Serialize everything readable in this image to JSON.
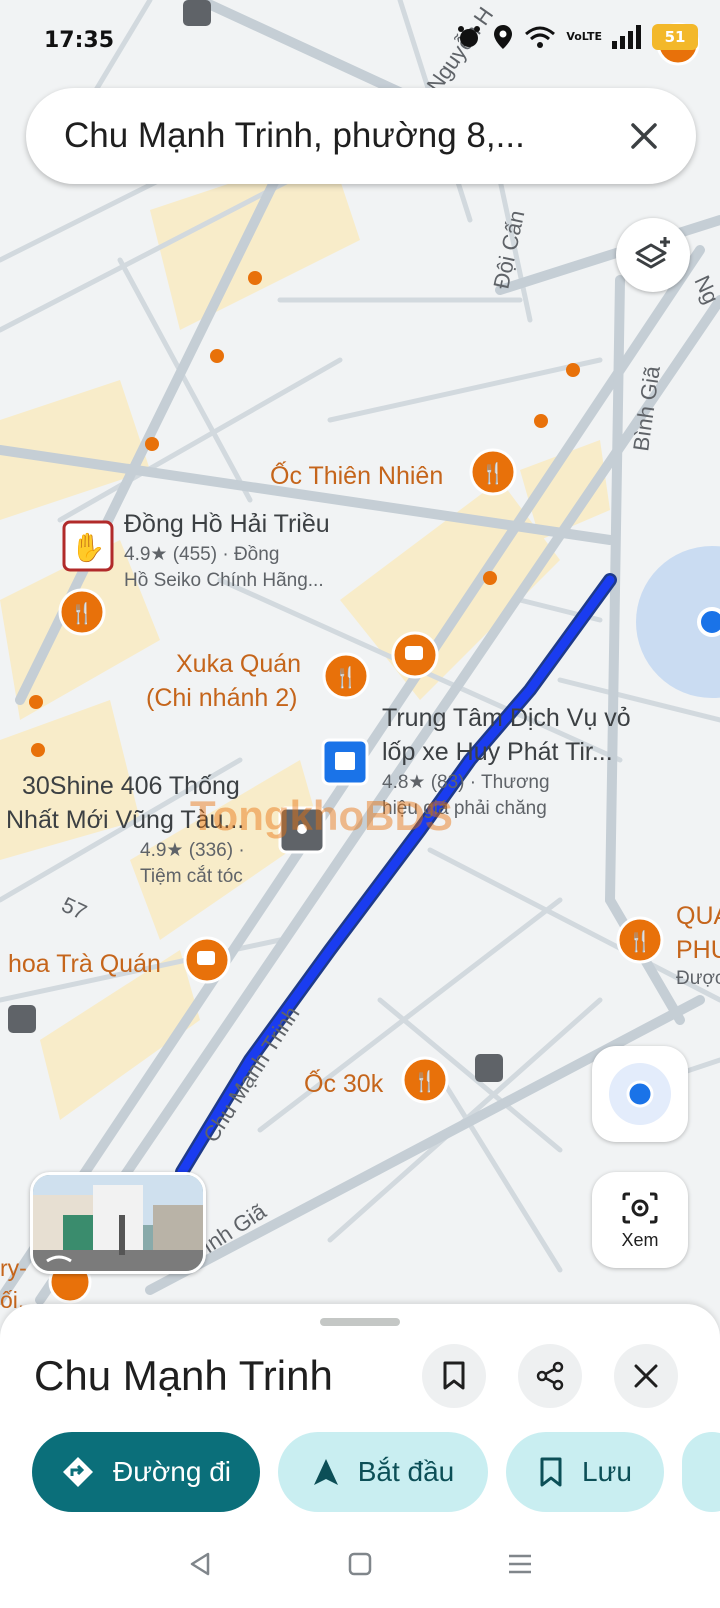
{
  "status_bar": {
    "time": "17:35",
    "battery": "51",
    "network": "VoLTE"
  },
  "search": {
    "query": "Chu Mạnh Trinh, phường 8,...",
    "close_icon": "close-icon"
  },
  "map": {
    "streets": [
      "Đội Cấn",
      "Bình Giã",
      "Chu Mạnh Trinh",
      "Bình Giã",
      "Nguyễn H",
      "57",
      "Ng"
    ],
    "places": [
      {
        "name": "Ốc Thiên Nhiên",
        "icon": "restaurant-icon"
      },
      {
        "name": "Đồng Hồ Hải Triều",
        "rating": "4.9★ (455) · Đồng",
        "subtitle": "Hồ Seiko Chính Hãng...",
        "icon": "store-logo-icon"
      },
      {
        "name_line1": "Xuka Quán",
        "name_line2": "(Chi nhánh 2)",
        "icon": "restaurant-icon"
      },
      {
        "name_line1": "Trung Tâm Dịch Vụ vỏ",
        "name_line2": "lốp xe Huy Phát Tir...",
        "rating": "4.8★ (83) · Thương",
        "subtitle": "hiệu giá phải chăng",
        "icon": "shopping-bag-icon"
      },
      {
        "name_line1": "30Shine 406 Thống",
        "name_line2": "Nhất Mới Vũng Tàu...",
        "rating": "4.9★ (336) ·",
        "subtitle": "Tiệm cắt tóc",
        "icon": "salon-icon"
      },
      {
        "name": "hoa Trà Quán",
        "icon": "cafe-icon"
      },
      {
        "name": "Ốc 30k",
        "icon": "restaurant-icon"
      },
      {
        "name_line1": "QUA",
        "name_line2": "PHU",
        "subtitle": "Được",
        "icon": "restaurant-icon"
      },
      {
        "name_line1": "ry-",
        "name_line2": "ối..",
        "icon": "restaurant-icon"
      }
    ],
    "watermark": "TongkhoBDS"
  },
  "controls": {
    "lens_label": "Xem"
  },
  "sheet": {
    "title": "Chu Mạnh Trinh",
    "chips": {
      "directions": "Đường đi",
      "start": "Bắt đầu",
      "save": "Lưu"
    }
  },
  "colors": {
    "route": "#1a3cf0",
    "poi_orange": "#e8710a",
    "poi_blue": "#1a73e8",
    "primary_chip": "#0b6f7a",
    "secondary_chip": "#c9eef1"
  }
}
